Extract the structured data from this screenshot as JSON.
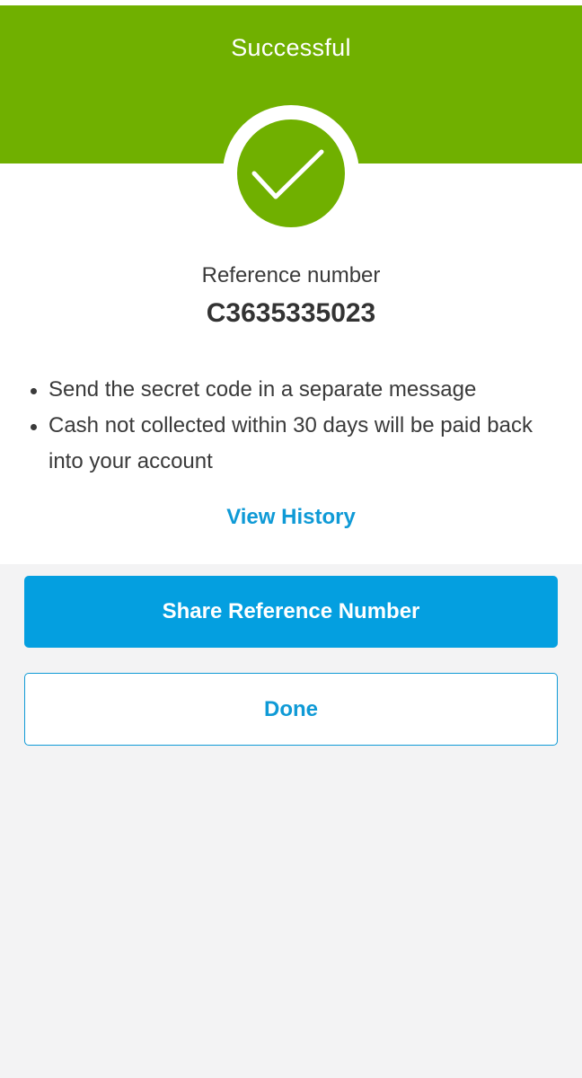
{
  "header": {
    "title": "Successful",
    "color": "#70b000",
    "icon": "checkmark-icon"
  },
  "reference": {
    "label": "Reference number",
    "number": "C3635335023"
  },
  "notes": [
    "Send the secret code in a separate message",
    "Cash not collected within 30 days will be paid back into your account"
  ],
  "links": {
    "view_history": "View History"
  },
  "actions": {
    "share_label": "Share Reference Number",
    "done_label": "Done",
    "accent": "#049fe0"
  }
}
